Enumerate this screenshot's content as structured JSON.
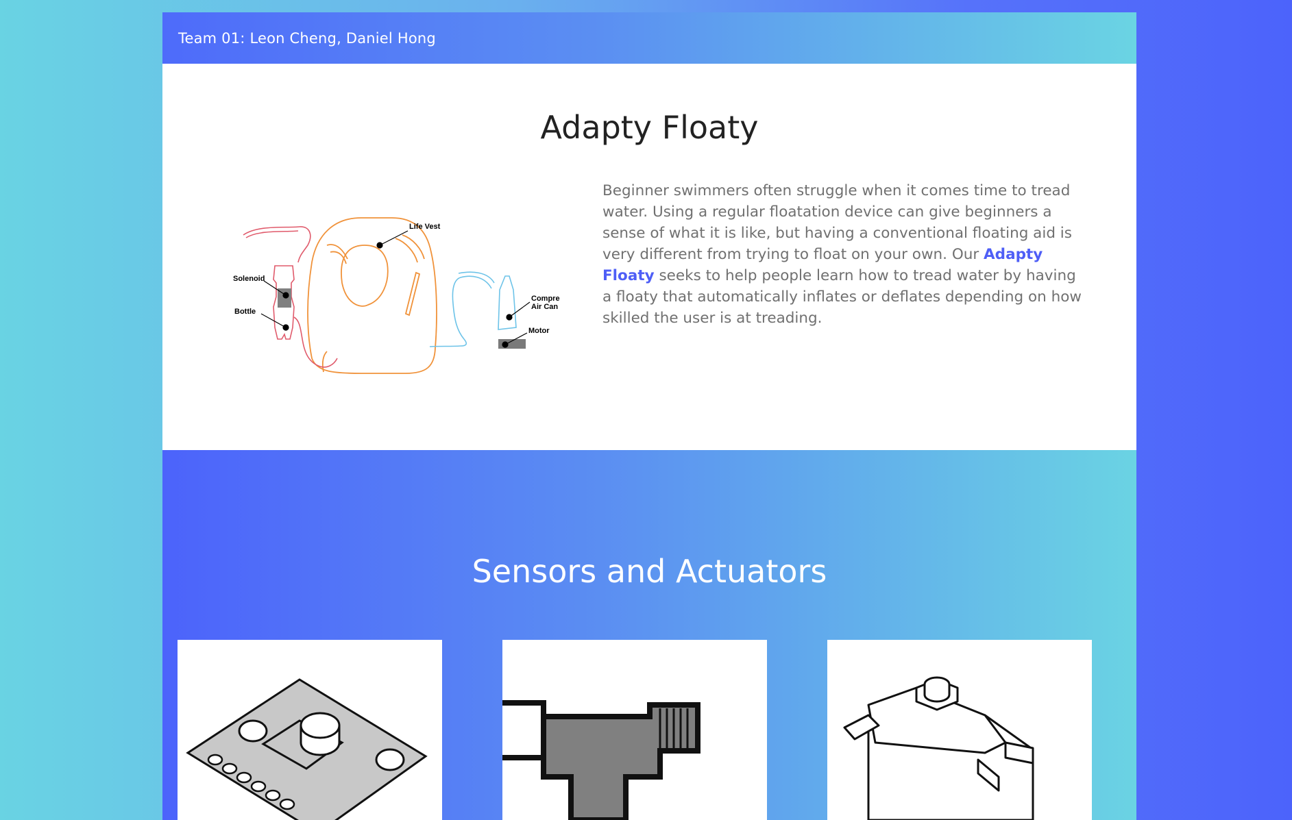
{
  "header": {
    "team": "Team 01: Leon Cheng, Daniel Hong"
  },
  "intro": {
    "title": "Adapty Floaty",
    "description_before": "Beginner swimmers often struggle when it comes time to tread water. Using a regular floatation device can give beginners a sense of what it is like, but having a conventional floating aid is very different from trying to float on your own. Our ",
    "description_highlight": "Adapty Floaty",
    "description_after": " seeks to help people learn how to tread water by having a floaty that automatically inflates or deflates depending on how skilled the user is at treading.",
    "diagram_labels": {
      "life_vest": "Life Vest",
      "solenoid": "Solenoid",
      "bottle": "Bottle",
      "compressed_line1": "Compressed",
      "compressed_line2": "Air Can",
      "motor": "Motor"
    }
  },
  "sensors": {
    "title": "Sensors and Actuators",
    "cards": [
      {
        "icon": "sensor-board-icon"
      },
      {
        "icon": "solenoid-valve-icon"
      },
      {
        "icon": "servo-motor-icon"
      }
    ]
  }
}
